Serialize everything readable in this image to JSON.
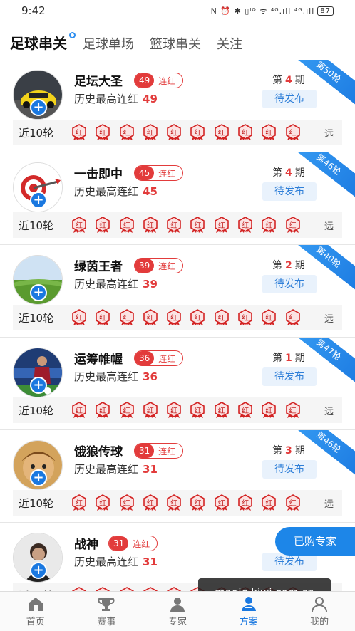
{
  "status_bar": {
    "time": "9:42",
    "icons_text": "N ⏰ ✱ ▯ᴵᴼ ᯤ ⁴ᴳ.ıll ⁴ᴳ.ıll",
    "battery": "87"
  },
  "tabs": [
    {
      "label": "足球串关",
      "active": true
    },
    {
      "label": "足球单场",
      "active": false
    },
    {
      "label": "篮球串关",
      "active": false
    },
    {
      "label": "关注",
      "active": false
    }
  ],
  "common": {
    "history_label": "历史最高连红",
    "streak_suffix": "连红",
    "period_prefix": "第",
    "period_suffix": "期",
    "pending": "待发布",
    "recent_label": "近10轮",
    "far_label": "远",
    "badge_text": "红",
    "plus": "+"
  },
  "experts": [
    {
      "name": "足坛大圣",
      "streak": "49",
      "history": "49",
      "period": "4",
      "ribbon": "第50轮",
      "avatar": "car",
      "recent": [
        "红",
        "红",
        "红",
        "红",
        "红",
        "红",
        "红",
        "红",
        "红",
        "红"
      ]
    },
    {
      "name": "一击即中",
      "streak": "45",
      "history": "45",
      "period": "4",
      "ribbon": "第46轮",
      "avatar": "dart",
      "recent": [
        "红",
        "红",
        "红",
        "红",
        "红",
        "红",
        "红",
        "红",
        "红",
        "红"
      ]
    },
    {
      "name": "绿茵王者",
      "streak": "39",
      "history": "39",
      "period": "2",
      "ribbon": "第40轮",
      "avatar": "field",
      "recent": [
        "红",
        "红",
        "红",
        "红",
        "红",
        "红",
        "红",
        "红",
        "红",
        "红"
      ]
    },
    {
      "name": "运筹帷幄",
      "streak": "36",
      "history": "36",
      "period": "1",
      "ribbon": "第47轮",
      "avatar": "player",
      "recent": [
        "红",
        "红",
        "红",
        "红",
        "红",
        "红",
        "红",
        "红",
        "红",
        "红"
      ]
    },
    {
      "name": "饿狼传球",
      "streak": "31",
      "history": "31",
      "period": "3",
      "ribbon": "第46轮",
      "avatar": "cartoon",
      "recent": [
        "红",
        "红",
        "红",
        "红",
        "红",
        "红",
        "红",
        "红",
        "红",
        "红"
      ]
    },
    {
      "name": "战神",
      "streak": "31",
      "history": "31",
      "period": "",
      "ribbon": "",
      "avatar": "man",
      "recent": [
        "红",
        "红",
        "红",
        "红",
        "红",
        "红",
        "红",
        "红",
        "红",
        "红"
      ]
    }
  ],
  "float_button": "已购专家",
  "watermark": "magic-kiwi.com.cn",
  "bottom_nav": [
    {
      "label": "首页",
      "icon": "home-icon",
      "active": false
    },
    {
      "label": "赛事",
      "icon": "trophy-icon",
      "active": false
    },
    {
      "label": "专家",
      "icon": "expert-icon",
      "active": false
    },
    {
      "label": "方案",
      "icon": "plan-icon",
      "active": true
    },
    {
      "label": "我的",
      "icon": "profile-icon",
      "active": false
    }
  ],
  "colors": {
    "accent": "#1a78e0",
    "red": "#e23b3b",
    "pending_bg": "#e9f2fc"
  }
}
